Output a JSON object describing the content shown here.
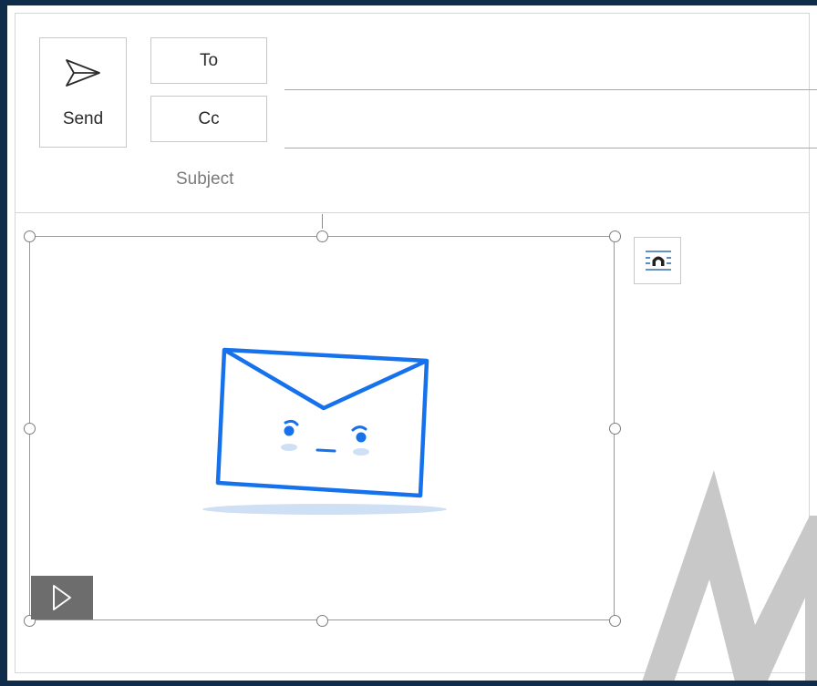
{
  "compose": {
    "send_label": "Send",
    "to_label": "To",
    "cc_label": "Cc",
    "subject_label": "Subject",
    "to_value": "",
    "cc_value": "",
    "subject_value": ""
  },
  "icons": {
    "send": "paper-plane-icon",
    "play": "play-icon",
    "layout_options": "layout-options-icon",
    "mascot": "envelope-mascot"
  },
  "colors": {
    "accent": "#1a73e8",
    "window_border": "#0f2d4a",
    "mascot_blue": "#1672ec"
  }
}
